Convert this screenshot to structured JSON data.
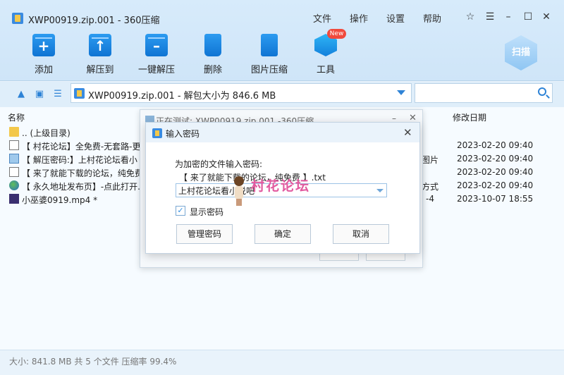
{
  "window": {
    "title": "XWP00919.zip.001 - 360压缩",
    "menu": [
      "文件",
      "操作",
      "设置",
      "帮助"
    ]
  },
  "toolbar": {
    "items": [
      {
        "label": "添加",
        "icon": "add-icon"
      },
      {
        "label": "解压到",
        "icon": "extract-to-icon"
      },
      {
        "label": "一键解压",
        "icon": "one-click-extract-icon"
      },
      {
        "label": "删除",
        "icon": "delete-icon"
      },
      {
        "label": "图片压缩",
        "icon": "image-compress-icon"
      },
      {
        "label": "工具",
        "icon": "tools-icon"
      }
    ],
    "new_badge": "New",
    "scan_label": "扫描"
  },
  "address_bar": {
    "path": "XWP00919.zip.001 - 解包大小为 846.6 MB",
    "search_placeholder": ""
  },
  "file_list": {
    "headers": {
      "name": "名称",
      "date": "修改日期"
    },
    "rows": [
      {
        "name": ".. (上级目录)",
        "extra": "",
        "date": "",
        "icon": "folder-icon"
      },
      {
        "name": "【 村花论坛】全免费-无套路-更",
        "extra": "",
        "date": "2023-02-20 09:40",
        "icon": "txt-file-icon"
      },
      {
        "name": "【 解压密码:】上村花论坛看小",
        "extra": "图片",
        "date": "2023-02-20 09:40",
        "icon": "jpg-file-icon"
      },
      {
        "name": "【 来了就能下载的论坛，纯免费",
        "extra": "",
        "date": "2023-02-20 09:40",
        "icon": "txt-file-icon"
      },
      {
        "name": "【 永久地址发布页】-点此打开.",
        "extra": "方式",
        "date": "2023-02-20 09:40",
        "icon": "url-file-icon"
      },
      {
        "name": "小巫婆0919.mp4 *",
        "extra": "-4",
        "date": "2023-10-07 18:55",
        "icon": "mp4-file-icon"
      }
    ]
  },
  "status_bar": {
    "text": "大小: 841.8 MB 共 5 个文件 压缩率 99.4%"
  },
  "test_dialog": {
    "title": "正在测试: XWP00919.zip.001 -360压缩"
  },
  "password_dialog": {
    "title": "输入密码",
    "prompt": "为加密的文件输入密码:",
    "file_name": "【 来了就能下载的论坛，纯免费 】.txt",
    "password_value": "上村花论坛看小说吧",
    "show_password_label": "显示密码",
    "show_password_checked": true,
    "buttons": {
      "manage": "管理密码",
      "ok": "确定",
      "cancel": "取消"
    }
  },
  "watermark": {
    "text": "村花论坛"
  }
}
